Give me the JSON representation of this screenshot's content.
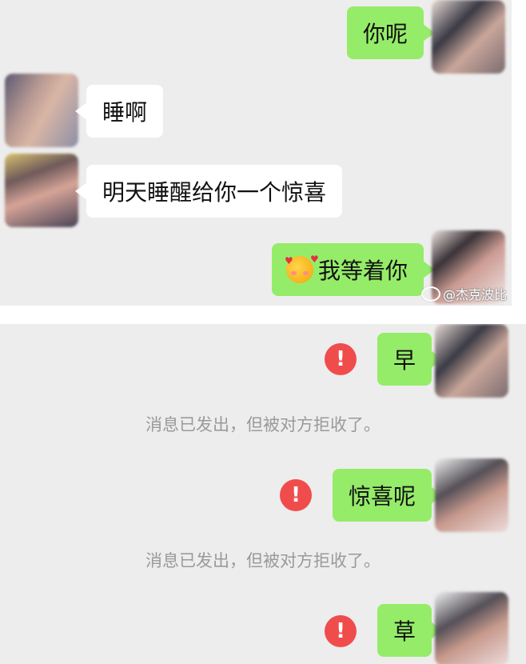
{
  "panel_top": {
    "messages": [
      {
        "side": "right",
        "text": "你呢"
      },
      {
        "side": "left",
        "text": "睡啊"
      },
      {
        "side": "left",
        "text": "明天睡醒给你一个惊喜"
      },
      {
        "side": "right",
        "text": "我等着你",
        "emoji": "smiling-face-with-hearts"
      }
    ],
    "watermark": "@杰克波比"
  },
  "panel_bottom": {
    "messages": [
      {
        "side": "right",
        "text": "早",
        "failed": true
      },
      {
        "side": "right",
        "text": "惊喜呢",
        "failed": true
      },
      {
        "side": "right",
        "text": "草",
        "failed": true
      }
    ],
    "error_symbol": "!",
    "system_notice": "消息已发出，但被对方拒收了。"
  },
  "colors": {
    "chat_background": "#ededed",
    "sent_bubble": "#95ec69",
    "received_bubble": "#ffffff",
    "error_icon": "#f04c4c",
    "system_text": "#9a9a9a"
  }
}
